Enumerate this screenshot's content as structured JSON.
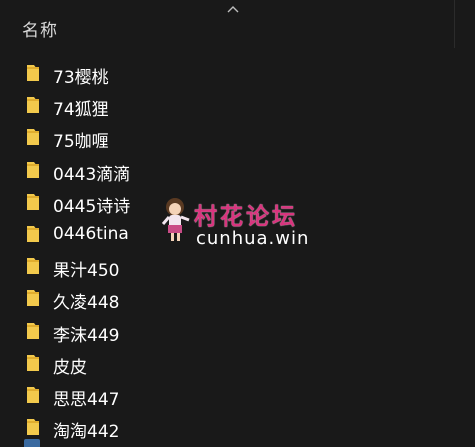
{
  "header": {
    "name_column": "名称",
    "sort_indicator": "chevron-up-icon"
  },
  "files": [
    {
      "label": "73樱桃",
      "icon": "folder-icon"
    },
    {
      "label": "74狐狸",
      "icon": "folder-icon"
    },
    {
      "label": "75咖喱",
      "icon": "folder-icon"
    },
    {
      "label": "0443滴滴",
      "icon": "folder-icon"
    },
    {
      "label": "0445诗诗",
      "icon": "folder-icon"
    },
    {
      "label": "0446tina",
      "icon": "folder-icon"
    },
    {
      "label": "果汁450",
      "icon": "folder-icon"
    },
    {
      "label": "久凌448",
      "icon": "folder-icon"
    },
    {
      "label": "李沫449",
      "icon": "folder-icon"
    },
    {
      "label": "皮皮",
      "icon": "folder-icon"
    },
    {
      "label": "思思447",
      "icon": "folder-icon"
    },
    {
      "label": "淘淘442",
      "icon": "folder-icon"
    }
  ],
  "watermark": {
    "title": "村花论坛",
    "url": "cunhua.win"
  },
  "colors": {
    "background": "#191919",
    "folder": "#f2c94c",
    "watermark_title": "#d8357e"
  }
}
